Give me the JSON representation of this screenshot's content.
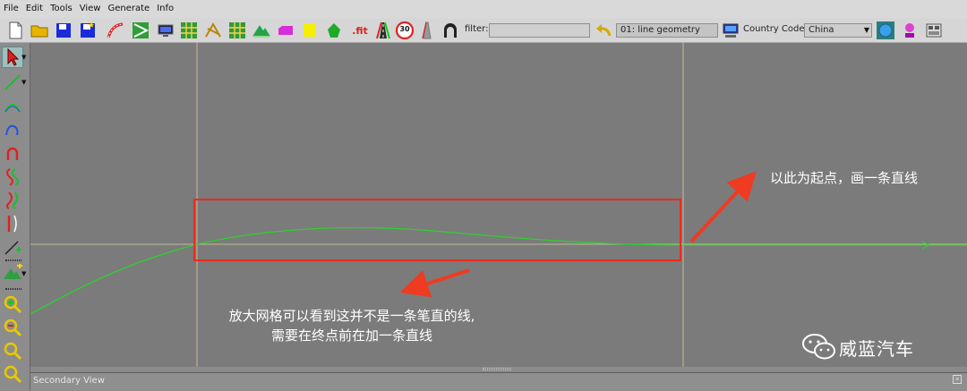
{
  "menubar": {
    "items": [
      {
        "label": "File"
      },
      {
        "label": "Edit"
      },
      {
        "label": "Tools"
      },
      {
        "label": "View"
      },
      {
        "label": "Generate"
      },
      {
        "label": "Info"
      }
    ]
  },
  "toolbar": {
    "speed_sign_text": "30",
    "fit_text": ".fit",
    "filter_label": "filter:",
    "filter_value": "",
    "geometry_value": "01: line geometry",
    "country_label": "Country Code:",
    "country_value": "China"
  },
  "viewport": {
    "annotation_right": "以此为起点，画一条直线",
    "annotation_bottom_line1": "放大网格可以看到这并不是一条笔直的线,",
    "annotation_bottom_line2": "需要在终点前在加一条直线",
    "colors": {
      "background": "#7b7b7b",
      "grid_line": "#c8b89a",
      "road_line": "#2fd02f",
      "highlight_box": "#ee2a1b",
      "arrow": "#ee3b22"
    }
  },
  "secondary_view": {
    "title": "Secondary View"
  },
  "watermark": {
    "text": "威蓝汽车"
  }
}
